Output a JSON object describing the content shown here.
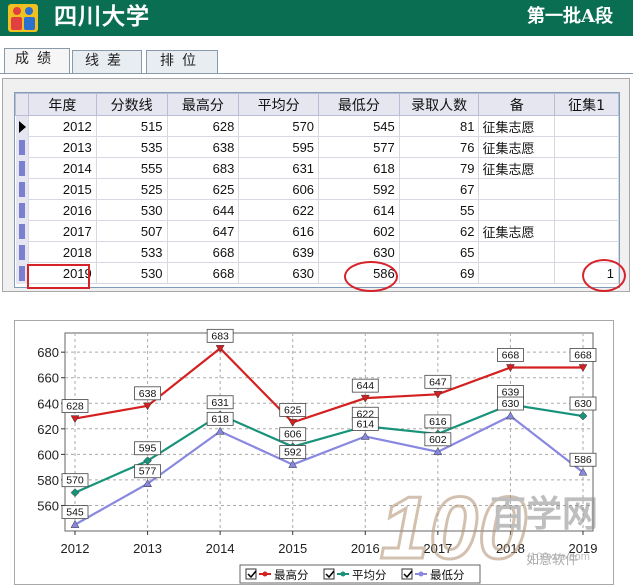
{
  "header": {
    "university": "四川大学",
    "batch": "第一批A段"
  },
  "tabs": [
    {
      "label": "成绩",
      "active": true
    },
    {
      "label": "线差",
      "active": false
    },
    {
      "label": "排位",
      "active": false
    }
  ],
  "table": {
    "columns": [
      "年度",
      "分数线",
      "最高分",
      "平均分",
      "最低分",
      "录取人数",
      "备",
      "征集1"
    ],
    "rows": [
      {
        "year": "2012",
        "line": "515",
        "max": "628",
        "avg": "570",
        "min": "545",
        "count": "81",
        "note": "征集志愿",
        "zj1": ""
      },
      {
        "year": "2013",
        "line": "535",
        "max": "638",
        "avg": "595",
        "min": "577",
        "count": "76",
        "note": "征集志愿",
        "zj1": ""
      },
      {
        "year": "2014",
        "line": "555",
        "max": "683",
        "avg": "631",
        "min": "618",
        "count": "79",
        "note": "征集志愿",
        "zj1": ""
      },
      {
        "year": "2015",
        "line": "525",
        "max": "625",
        "avg": "606",
        "min": "592",
        "count": "67",
        "note": "",
        "zj1": ""
      },
      {
        "year": "2016",
        "line": "530",
        "max": "644",
        "avg": "622",
        "min": "614",
        "count": "55",
        "note": "",
        "zj1": ""
      },
      {
        "year": "2017",
        "line": "507",
        "max": "647",
        "avg": "616",
        "min": "602",
        "count": "62",
        "note": "征集志愿",
        "zj1": ""
      },
      {
        "year": "2018",
        "line": "533",
        "max": "668",
        "avg": "639",
        "min": "630",
        "count": "65",
        "note": "",
        "zj1": ""
      },
      {
        "year": "2019",
        "line": "530",
        "max": "668",
        "avg": "630",
        "min": "586",
        "count": "69",
        "note": "",
        "zj1": "1"
      }
    ]
  },
  "chart_data": {
    "type": "line",
    "x": [
      "2012",
      "2013",
      "2014",
      "2015",
      "2016",
      "2017",
      "2018",
      "2019"
    ],
    "series": [
      {
        "name": "最高分",
        "color": "#d42020",
        "values": [
          628,
          638,
          683,
          625,
          644,
          647,
          668,
          668
        ]
      },
      {
        "name": "平均分",
        "color": "#18937a",
        "values": [
          570,
          595,
          631,
          606,
          622,
          616,
          639,
          630
        ]
      },
      {
        "name": "最低分",
        "color": "#8888e0",
        "values": [
          545,
          577,
          618,
          592,
          614,
          602,
          630,
          586
        ]
      }
    ],
    "yticks": [
      560,
      580,
      600,
      620,
      640,
      660,
      680
    ],
    "ylim": [
      540,
      695
    ],
    "grid": true,
    "legend_position": "bottom"
  },
  "watermark": {
    "brand": "百学网",
    "number": "100",
    "site": "100xue.com",
    "overlay": "如意软件"
  }
}
